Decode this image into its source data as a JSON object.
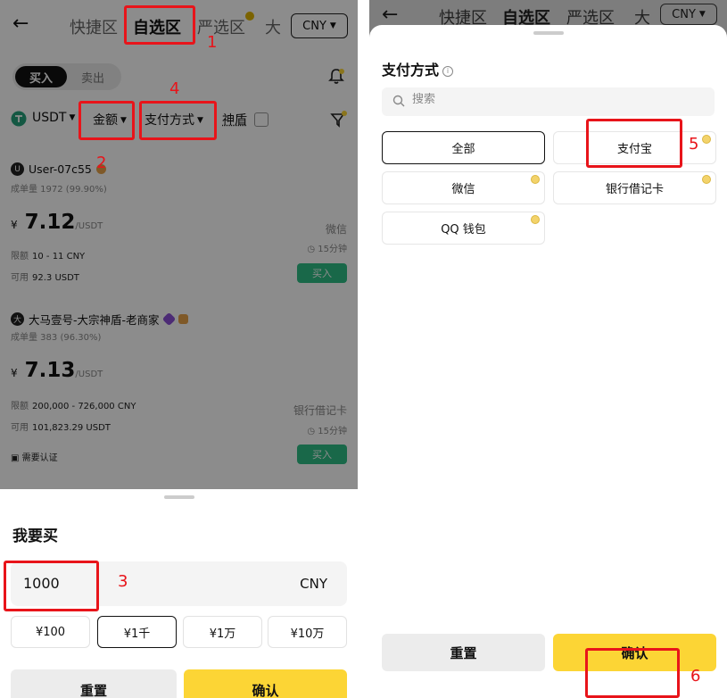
{
  "left": {
    "nav": {
      "back_icon": "arrow-left-icon",
      "tabs": [
        "快捷区",
        "自选区",
        "严选区",
        "大"
      ],
      "active_tab": "自选区",
      "currency": "CNY"
    },
    "segment": {
      "buy": "买入",
      "sell": "卖出"
    },
    "filters": {
      "coin": "USDT",
      "amount": "金额",
      "payment": "支付方式",
      "shield": "神盾"
    },
    "ads": [
      {
        "merchant": "User-07c55",
        "avatar": "U",
        "trades": "成单量 1972 (99.90%)",
        "currency_symbol": "¥",
        "price": "7.12",
        "unit": "/USDT",
        "limit_label": "限额",
        "limit": "10 - 11 CNY",
        "available_label": "可用",
        "available": "92.3 USDT",
        "payment": "微信",
        "time": "15分钟",
        "button": "买入"
      },
      {
        "merchant": "大马壹号-大宗神盾-老商家",
        "avatar": "大",
        "trades": "成单量 383 (96.30%)",
        "currency_symbol": "¥",
        "price": "7.13",
        "unit": "/USDT",
        "limit_label": "限额",
        "limit": "200,000 - 726,000 CNY",
        "available_label": "可用",
        "available": "101,823.29 USDT",
        "payment": "银行借记卡",
        "time": "15分钟",
        "verify": "需要认证",
        "button": "买入"
      }
    ],
    "sheet": {
      "title": "我要买",
      "amount_value": "1000",
      "amount_unit": "CNY",
      "chips": [
        "¥100",
        "¥1千",
        "¥1万",
        "¥10万"
      ],
      "selected_chip": "¥1千",
      "reset": "重置",
      "confirm": "确认"
    },
    "annotations": [
      "1",
      "2",
      "3",
      "4"
    ]
  },
  "right": {
    "nav": {
      "tabs": [
        "快捷区",
        "自选区",
        "严选区",
        "大"
      ],
      "currency": "CNY"
    },
    "title": "支付方式",
    "info_icon": "info-icon",
    "search_placeholder": "搜索",
    "options": [
      "全部",
      "支付宝",
      "微信",
      "银行借记卡",
      "QQ 钱包"
    ],
    "selected_option": "全部",
    "reset": "重置",
    "confirm": "确认",
    "annotations": [
      "5",
      "6"
    ]
  },
  "colors": {
    "accent_yellow": "#fcd535",
    "buy_green": "#2ebd85",
    "annotation_red": "#e8141a",
    "dark": "#111111"
  }
}
